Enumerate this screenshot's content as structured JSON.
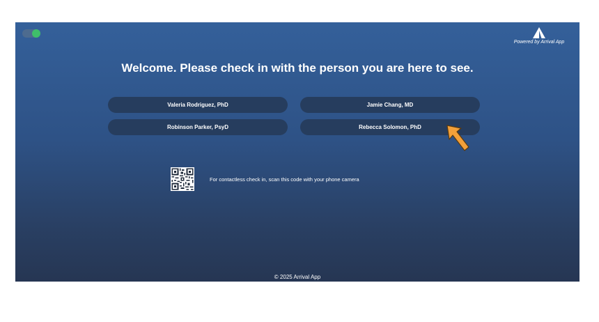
{
  "header": {
    "powered_by": "Powered by Arrival App",
    "logo_icon": "arrival-logo-icon",
    "toggle_icon": "status-toggle-icon"
  },
  "main": {
    "welcome": "Welcome.  Please check in with the person you are here to see.",
    "providers": [
      {
        "name": "Valeria Rodriguez, PhD"
      },
      {
        "name": "Jamie Chang, MD"
      },
      {
        "name": "Robinson Parker, PsyD"
      },
      {
        "name": "Rebecca Solomon, PhD"
      }
    ],
    "contactless": "For contactless check in, scan this code with your phone camera",
    "qr_icon": "qr-code-icon"
  },
  "footer": {
    "copyright": "© 2025 Arrival App"
  },
  "annotation": {
    "pointer_icon": "orange-arrow-icon",
    "color": "#f2a03a"
  },
  "colors": {
    "background_top": "#34609a",
    "background_bottom": "#263653",
    "button": "#263d5e",
    "toggle_on": "#3fbf6a"
  }
}
